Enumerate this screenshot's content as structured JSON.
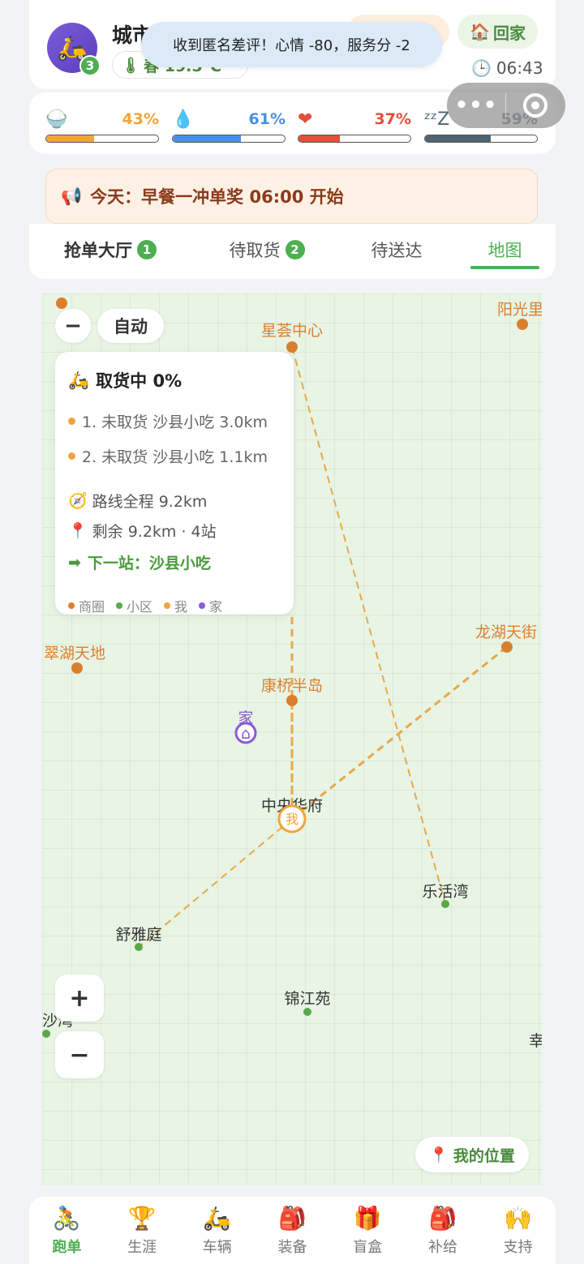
{
  "header": {
    "avatar_icon": "scooter-icon",
    "level": "3",
    "city_title": "城市新星",
    "weather": "春 19.5°C",
    "home_label": "回家",
    "time": "06:43",
    "toast": "收到匿名差评！心情 -80，服务分 -2"
  },
  "stats": [
    {
      "name": "hunger",
      "icon": "rice-bowl-icon",
      "value": "43%",
      "fill": 0.43,
      "color": "#f0a43c"
    },
    {
      "name": "water",
      "icon": "water-drop-icon",
      "value": "61%",
      "fill": 0.61,
      "color": "#4a90e2"
    },
    {
      "name": "health",
      "icon": "heart-icon",
      "value": "37%",
      "fill": 0.37,
      "color": "#e0503c"
    },
    {
      "name": "sleep",
      "icon": "sleep-zzz-icon",
      "value": "59%",
      "fill": 0.59,
      "color": "#4d6472"
    }
  ],
  "announcement": "今天：早餐一冲单奖 06:00 开始",
  "tabs": [
    {
      "label": "抢单大厅",
      "count": "1"
    },
    {
      "label": "待取货",
      "count": "2"
    },
    {
      "label": "待送达",
      "count": ""
    },
    {
      "label": "地图",
      "count": ""
    }
  ],
  "map": {
    "auto_label": "自动",
    "zoom_in": "+",
    "zoom_out": "−",
    "zoom_minus_top": "−",
    "my_location_label": "我的位置",
    "places": {
      "xinghui": "星荟中心",
      "yangguang": "阳光里",
      "cuihu": "翠湖天地",
      "longhu": "龙湖天街",
      "kangqiao": "康桥半岛",
      "zhongyang": "中央华府",
      "lehuo": "乐活湾",
      "shuya": "舒雅庭",
      "jinjiang": "锦江苑",
      "shawan": "沙湾",
      "xing": "幸",
      "home": "家",
      "me": "我"
    },
    "route_card": {
      "title": "取货中 0%",
      "stops": [
        "1. 未取货 沙县小吃 3.0km",
        "2. 未取货 沙县小吃 1.1km"
      ],
      "total": "路线全程 9.2km",
      "remaining": "剩余 9.2km · 4站",
      "next_stop": "下一站：沙县小吃",
      "legend": [
        "商圈",
        "小区",
        "我",
        "家"
      ]
    }
  },
  "bottom_nav": [
    {
      "label": "跑单",
      "icon": "cyclist-icon"
    },
    {
      "label": "生涯",
      "icon": "trophy-icon"
    },
    {
      "label": "车辆",
      "icon": "scooter-icon"
    },
    {
      "label": "装备",
      "icon": "backpack-icon"
    },
    {
      "label": "盲盒",
      "icon": "gift-icon"
    },
    {
      "label": "补给",
      "icon": "backpack-icon"
    },
    {
      "label": "支持",
      "icon": "raised-hands-icon"
    }
  ],
  "colors": {
    "accent_green": "#4caf50",
    "commercial": "#d98030",
    "residential": "#5aa84a",
    "me": "#f0a43c",
    "home": "#8a5ad6",
    "route": "#e8a84a"
  }
}
